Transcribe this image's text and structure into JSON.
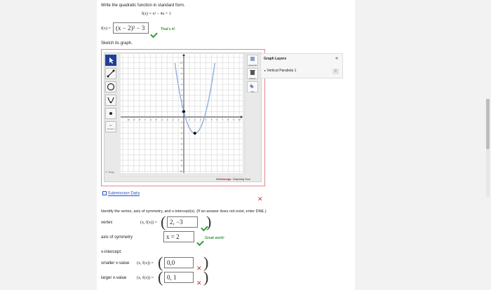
{
  "problem": {
    "instruction": "Write the quadratic function in standard form.",
    "given": "f(x) = x² − 4x + 1",
    "fx_label": "f(x) =",
    "answer_value": "(x − 2)² − 3",
    "answer_feedback": "That's it!"
  },
  "sketch_label": "Sketch its graph.",
  "graph": {
    "tools": [
      "pointer-tool",
      "line-tool",
      "circle-tool",
      "parabola-tool",
      "point-tool",
      "no-solution-tool"
    ],
    "no_solution_label": "No Solution",
    "right_tools": [
      "Clear All",
      "Delete",
      "Fill"
    ],
    "x_ticks": [
      "-10",
      "-9",
      "-8",
      "-7",
      "-6",
      "-5",
      "-4",
      "-3",
      "-2",
      "-1",
      "1",
      "2",
      "3",
      "4",
      "5",
      "6",
      "7",
      "8",
      "9",
      "10"
    ],
    "y_ticks": [
      "10",
      "9",
      "8",
      "7",
      "6",
      "5",
      "4",
      "3",
      "2",
      "1",
      "-1",
      "-2",
      "-3",
      "-4",
      "-5",
      "-6",
      "-7",
      "-8",
      "-9",
      "-10"
    ],
    "help_label": "Help",
    "brand_web": "Web",
    "brand_assign": "Assign",
    "brand_rest": ". Graphing Tool",
    "curve": {
      "type": "parabola",
      "a": 1,
      "h": 2,
      "k": -3
    },
    "points": [
      {
        "x": 0,
        "y": 1
      },
      {
        "x": 2,
        "y": -3
      }
    ],
    "colors": {
      "curve": "#8fb0dc",
      "toolbar_active": "#1f3f9a",
      "frame": "#e08a8a"
    }
  },
  "layers": {
    "title": "Graph Layers",
    "collapse_icon": "«",
    "items": [
      {
        "label": "Vertical Parabola 1",
        "close": "✕"
      }
    ]
  },
  "submission_link": "Submission Data",
  "identify": {
    "instruction": "Identify the vertex, axis of symmetry, and x-intercept(s). (If an answer does not exist, enter DNE.)",
    "vertex_label": "vertex",
    "pair_label": "(x, f(x)) =",
    "vertex_value": "2, −3",
    "axis_label": "axis of symmetry",
    "axis_value": "x = 2",
    "axis_feedback": "Great work!",
    "intercept_label": "x-intercept:",
    "smaller_label": "smaller x-value",
    "smaller_value": "0,0",
    "larger_label": "larger x-value",
    "larger_value": "0, 1"
  }
}
